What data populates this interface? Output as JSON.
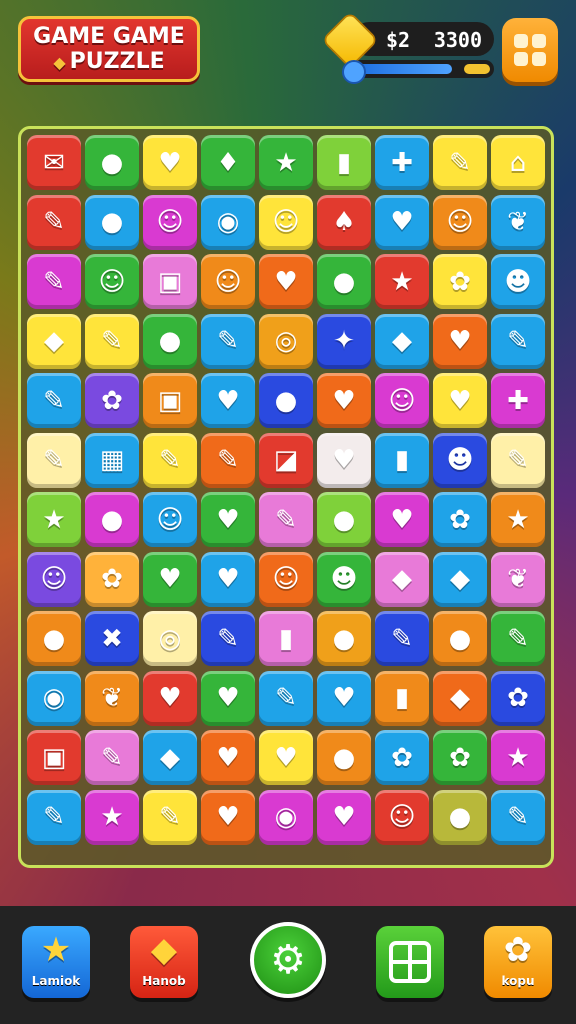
{
  "header": {
    "title_line1": "GAME GAME",
    "title_line2": "PUZZLE",
    "coins_left": "$2",
    "coins_right": "3300",
    "energy_fraction": 0.72
  },
  "board": {
    "rows": [
      [
        [
          "#e23a2e",
          "✉"
        ],
        [
          "#35b53a",
          "●"
        ],
        [
          "#ffe43a",
          "♥"
        ],
        [
          "#35b53a",
          "♦"
        ],
        [
          "#35b53a",
          "★"
        ],
        [
          "#7fd13a",
          "▮"
        ],
        [
          "#1fa3e8",
          "✚"
        ],
        [
          "#ffe43a",
          "✎"
        ],
        [
          "#ffe43a",
          "⌂"
        ]
      ],
      [
        [
          "#e23a2e",
          "✎"
        ],
        [
          "#1fa3e8",
          "●"
        ],
        [
          "#d93ad1",
          "☺"
        ],
        [
          "#1fa3e8",
          "◉"
        ],
        [
          "#ffe43a",
          "☺"
        ],
        [
          "#e23a2e",
          "♠"
        ],
        [
          "#1fa3e8",
          "♥"
        ],
        [
          "#f08a1a",
          "☺"
        ],
        [
          "#1fa3e8",
          "❦"
        ]
      ],
      [
        [
          "#d93ad1",
          "✎"
        ],
        [
          "#35b53a",
          "☺"
        ],
        [
          "#e87ad8",
          "▣"
        ],
        [
          "#f08a1a",
          "☺"
        ],
        [
          "#f06a1a",
          "♥"
        ],
        [
          "#35b53a",
          "●"
        ],
        [
          "#e23a2e",
          "★"
        ],
        [
          "#ffe43a",
          "✿"
        ],
        [
          "#1fa3e8",
          "☻"
        ]
      ],
      [
        [
          "#ffe43a",
          "◆"
        ],
        [
          "#ffe43a",
          "✎"
        ],
        [
          "#35b53a",
          "●"
        ],
        [
          "#1fa3e8",
          "✎"
        ],
        [
          "#f0a01a",
          "◎"
        ],
        [
          "#2a4ae0",
          "✦"
        ],
        [
          "#1fa3e8",
          "◆"
        ],
        [
          "#f06a1a",
          "♥"
        ],
        [
          "#1fa3e8",
          "✎"
        ]
      ],
      [
        [
          "#1fa3e8",
          "✎"
        ],
        [
          "#7a4ae0",
          "✿"
        ],
        [
          "#f08a1a",
          "▣"
        ],
        [
          "#1fa3e8",
          "♥"
        ],
        [
          "#2a4ae0",
          "●"
        ],
        [
          "#f06a1a",
          "♥"
        ],
        [
          "#d93ad1",
          "☺"
        ],
        [
          "#ffe43a",
          "♥"
        ],
        [
          "#d93ad1",
          "✚"
        ]
      ],
      [
        [
          "#fff0a8",
          "✎"
        ],
        [
          "#1fa3e8",
          "▦"
        ],
        [
          "#ffe43a",
          "✎"
        ],
        [
          "#f06a1a",
          "✎"
        ],
        [
          "#e23a2e",
          "◪"
        ],
        [
          "#f3ecec",
          "♥"
        ],
        [
          "#1fa3e8",
          "▮"
        ],
        [
          "#2a4ae0",
          "☻"
        ],
        [
          "#fff0a8",
          "✎"
        ]
      ],
      [
        [
          "#7fd13a",
          "★"
        ],
        [
          "#d93ad1",
          "●"
        ],
        [
          "#1fa3e8",
          "☺"
        ],
        [
          "#35b53a",
          "♥"
        ],
        [
          "#e87ad8",
          "✎"
        ],
        [
          "#7fd13a",
          "●"
        ],
        [
          "#d93ad1",
          "♥"
        ],
        [
          "#1fa3e8",
          "✿"
        ],
        [
          "#f08a1a",
          "★"
        ]
      ],
      [
        [
          "#7a4ae0",
          "☺"
        ],
        [
          "#ffb23a",
          "✿"
        ],
        [
          "#35b53a",
          "♥"
        ],
        [
          "#1fa3e8",
          "♥"
        ],
        [
          "#f06a1a",
          "☺"
        ],
        [
          "#35b53a",
          "☻"
        ],
        [
          "#e87ad8",
          "◆"
        ],
        [
          "#1fa3e8",
          "◆"
        ],
        [
          "#e87ad8",
          "❦"
        ]
      ],
      [
        [
          "#f08a1a",
          "●"
        ],
        [
          "#2a4ae0",
          "✖"
        ],
        [
          "#fff0a8",
          "◎"
        ],
        [
          "#2a4ae0",
          "✎"
        ],
        [
          "#e87ad8",
          "▮"
        ],
        [
          "#f0a01a",
          "●"
        ],
        [
          "#2a4ae0",
          "✎"
        ],
        [
          "#f08a1a",
          "●"
        ],
        [
          "#35b53a",
          "✎"
        ]
      ],
      [
        [
          "#1fa3e8",
          "◉"
        ],
        [
          "#f08a1a",
          "❦"
        ],
        [
          "#e23a2e",
          "♥"
        ],
        [
          "#35b53a",
          "♥"
        ],
        [
          "#1fa3e8",
          "✎"
        ],
        [
          "#1fa3e8",
          "♥"
        ],
        [
          "#f08a1a",
          "▮"
        ],
        [
          "#f06a1a",
          "◆"
        ],
        [
          "#2a4ae0",
          "✿"
        ]
      ],
      [
        [
          "#e23a2e",
          "▣"
        ],
        [
          "#e87ad8",
          "✎"
        ],
        [
          "#1fa3e8",
          "◆"
        ],
        [
          "#f06a1a",
          "♥"
        ],
        [
          "#ffe43a",
          "♥"
        ],
        [
          "#f08a1a",
          "●"
        ],
        [
          "#1fa3e8",
          "✿"
        ],
        [
          "#35b53a",
          "✿"
        ],
        [
          "#d93ad1",
          "★"
        ]
      ],
      [
        [
          "#1fa3e8",
          "✎"
        ],
        [
          "#d93ad1",
          "★"
        ],
        [
          "#ffe43a",
          "✎"
        ],
        [
          "#f06a1a",
          "♥"
        ],
        [
          "#d93ad1",
          "◉"
        ],
        [
          "#d93ad1",
          "♥"
        ],
        [
          "#e23a2e",
          "☺"
        ],
        [
          "#b8b83a",
          "●"
        ],
        [
          "#1fa3e8",
          "✎"
        ]
      ]
    ]
  },
  "nav": {
    "left_label": "Lamiok",
    "left_icon": "star-icon",
    "second_label": "Hanob",
    "second_icon": "diamond-icon",
    "center_icon": "gear-icon",
    "fourth_icon": "grid-icon",
    "right_label": "kopu",
    "right_icon": "cog-icon"
  }
}
